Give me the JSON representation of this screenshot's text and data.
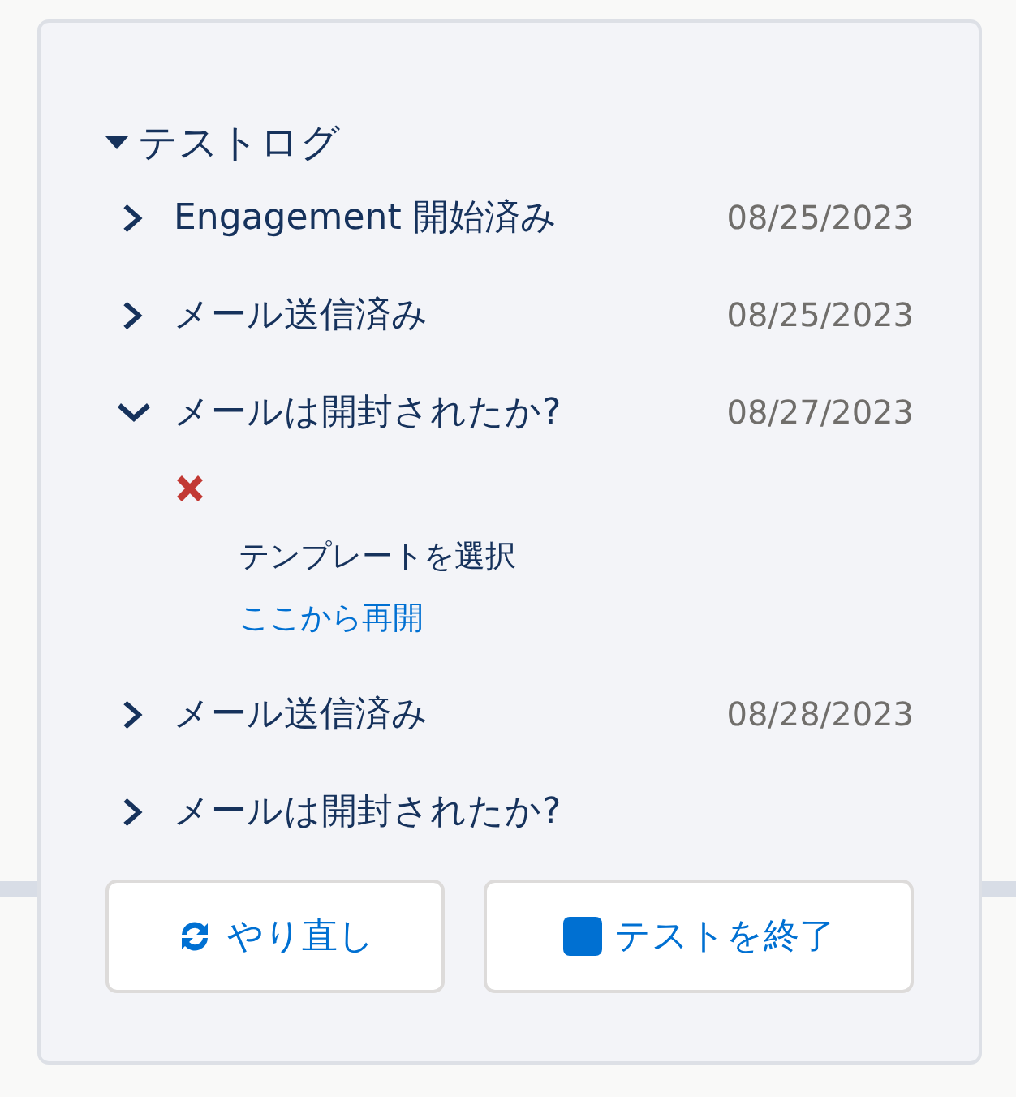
{
  "test_log": {
    "title": "テストログ",
    "expanded": true,
    "entries": [
      {
        "label": "Engagement 開始済み",
        "date": "08/25/2023",
        "expanded": false
      },
      {
        "label": "メール送信済み",
        "date": "08/25/2023",
        "expanded": false
      },
      {
        "label": "メールは開封されたか?",
        "date": "08/27/2023",
        "expanded": true,
        "failed": true,
        "detail": "テンプレートを選択",
        "link": "ここから再開"
      },
      {
        "label": "メール送信済み",
        "date": "08/28/2023",
        "expanded": false
      },
      {
        "label": "メールは開封されたか?",
        "expanded": false
      }
    ]
  },
  "buttons": [
    {
      "label": "やり直し",
      "kind": "restart"
    },
    {
      "label": "テストを終了",
      "kind": "stop"
    }
  ]
}
